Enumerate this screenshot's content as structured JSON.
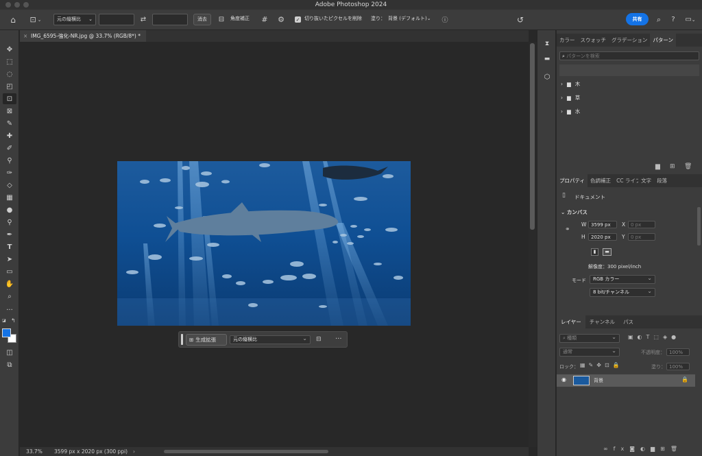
{
  "window": {
    "title": "Adobe Photoshop 2024"
  },
  "options": {
    "ratio": "元の縦横比",
    "clear_label": "消去",
    "straighten_label": "角度補正",
    "delete_cropped_label": "切り抜いたピクセルを削除",
    "fill_label": "塗り：",
    "fill_value": "背景 (デフォルト)",
    "share_label": "共有"
  },
  "document": {
    "tab_title": "IMG_6595-強化-NR.jpg @ 33.7% (RGB/8*) *"
  },
  "context_bar": {
    "generate_label": "生成拡張",
    "ratio": "元の縦横比"
  },
  "status": {
    "zoom": "33.7%",
    "info": "3599 px x 2020 px (300 ppi)"
  },
  "pattern_panel": {
    "tabs": [
      "カラー",
      "スウォッチ",
      "グラデーション",
      "パターン"
    ],
    "search_placeholder": "パターンを検索",
    "folders": [
      "木",
      "草",
      "水"
    ]
  },
  "properties_panel": {
    "tabs": [
      "プロパティ",
      "色調補正",
      "CC ライブ",
      "文字",
      "段落"
    ],
    "doc_label": "ドキュメント",
    "canvas_label": "カンバス",
    "w_label": "W",
    "w_value": "3599 px",
    "h_label": "H",
    "h_value": "2020 px",
    "x_label": "X",
    "x_value": "0 px",
    "y_label": "Y",
    "y_value": "0 px",
    "resolution": "解像度：300 pixel/inch",
    "mode_label": "モード",
    "mode_value": "RGB カラー",
    "bit_value": "8 bit/チャンネル"
  },
  "layers_panel": {
    "tabs": [
      "レイヤー",
      "チャンネル",
      "パス"
    ],
    "filter_placeholder": "種類",
    "blend_mode": "通常",
    "opacity_label": "不透明度：",
    "opacity_value": "100%",
    "lock_label": "ロック：",
    "fill_label": "塗り：",
    "fill_value": "100%",
    "layer_name": "背景"
  },
  "colors": {
    "accent": "#1473e6",
    "fg": "#1473e6",
    "bg": "#ffffff"
  }
}
